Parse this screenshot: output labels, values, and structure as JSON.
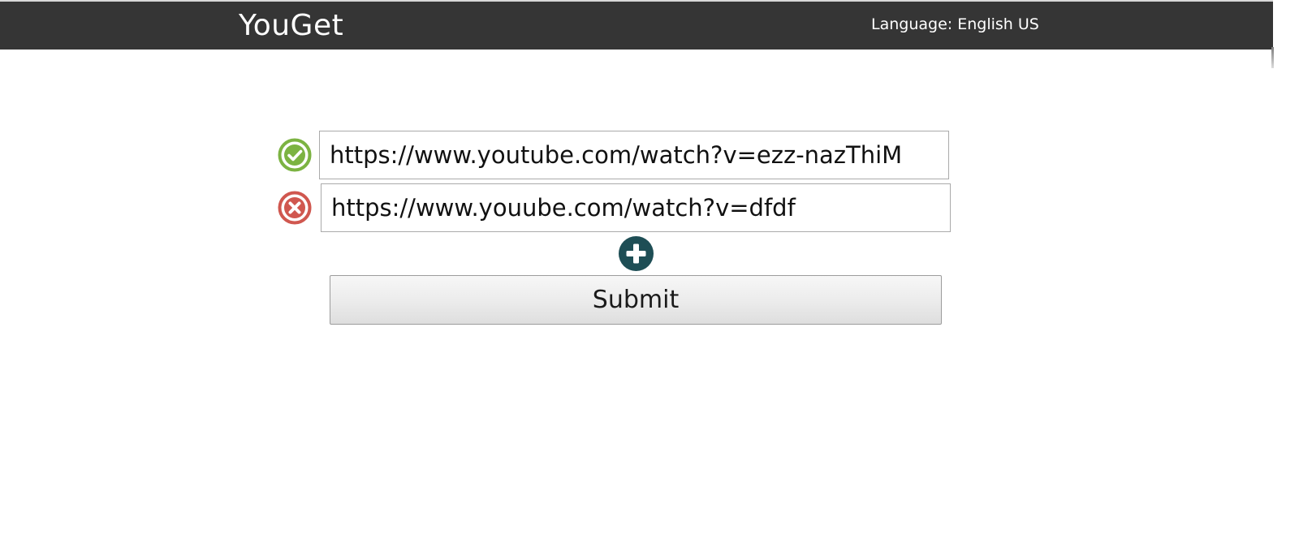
{
  "header": {
    "brand": "YouGet",
    "language_label": "Language: English US"
  },
  "form": {
    "urls": [
      {
        "value": "https://www.youtube.com/watch?v=ezz-nazThiM",
        "status": "valid",
        "icon": "check-circle-icon",
        "color": "#7cb342"
      },
      {
        "value": "https://www.youube.com/watch?v=dfdf",
        "status": "invalid",
        "icon": "x-circle-icon",
        "color": "#d0574f"
      }
    ],
    "add_button_icon": "plus-circle-icon",
    "add_button_color": "#1e4e55",
    "submit_label": "Submit"
  },
  "colors": {
    "header_bg": "#353535",
    "valid": "#7cb342",
    "invalid": "#d0574f",
    "accent": "#1e4e55"
  }
}
